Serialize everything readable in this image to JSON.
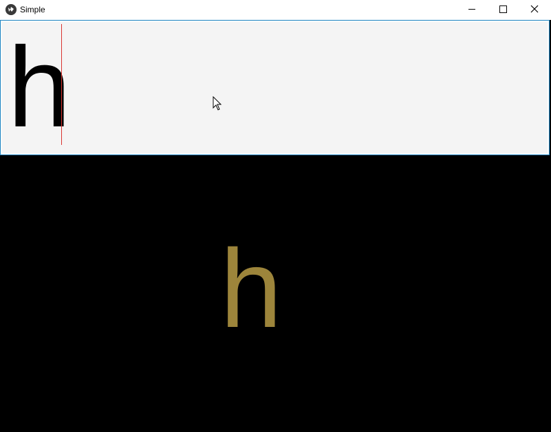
{
  "window": {
    "title": "Simple",
    "app_icon": "kivy-logo-icon"
  },
  "caption_buttons": {
    "minimize_icon": "minimize-icon",
    "maximize_icon": "maximize-icon",
    "close_icon": "close-icon"
  },
  "text_input": {
    "value": "h",
    "caret_color": "#d9332e",
    "border_color": "#1e88c7",
    "background": "#f4f4f4"
  },
  "output_label": {
    "text": "h",
    "color": "#9d853b"
  },
  "mouse_cursor": "arrow-cursor-icon"
}
